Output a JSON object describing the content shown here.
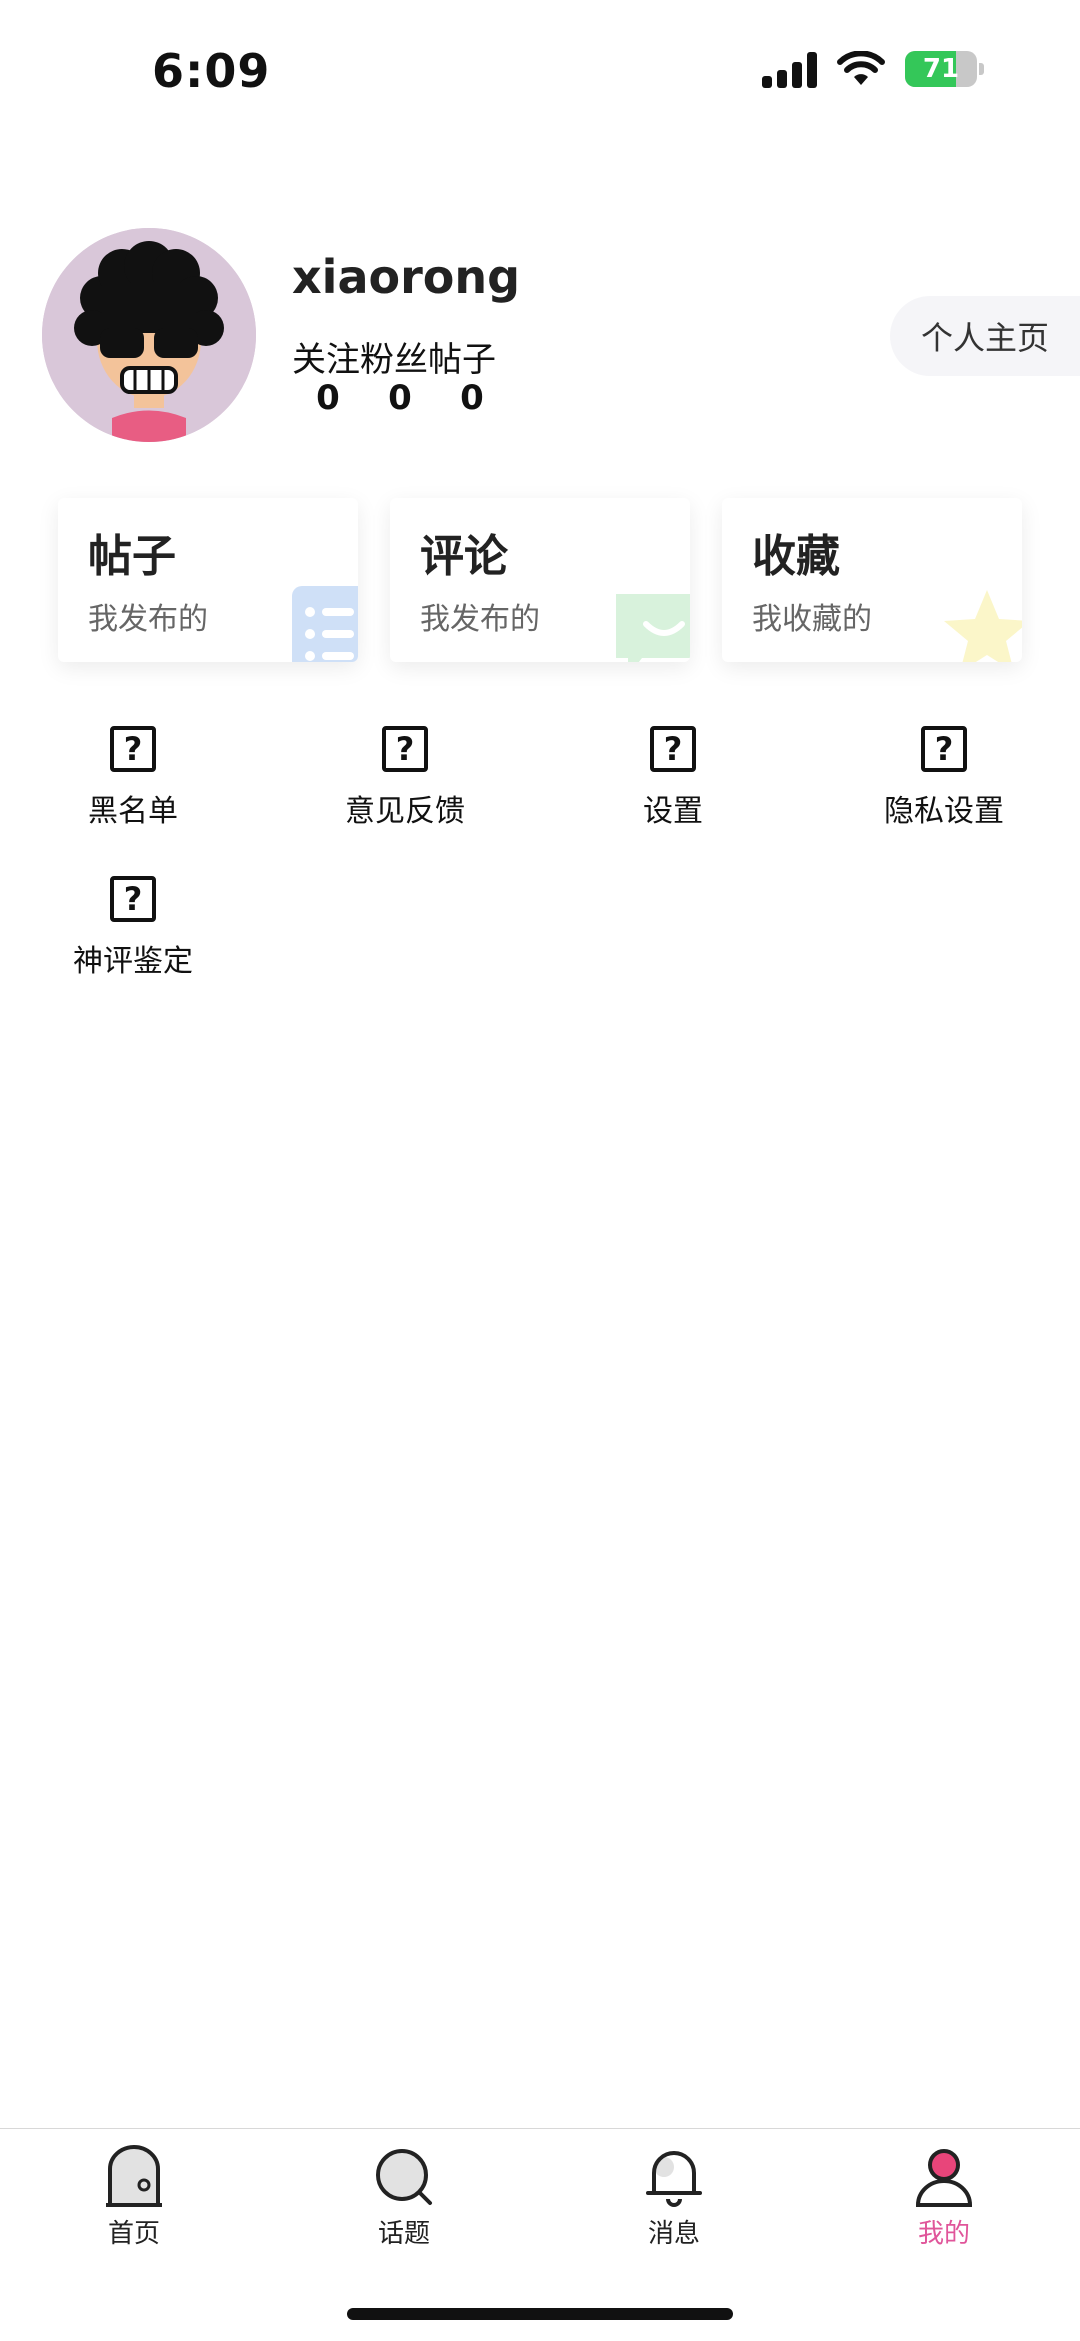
{
  "status_bar": {
    "time": "6:09",
    "battery_level": "71",
    "icons": [
      "signal-icon",
      "wifi-icon",
      "battery-icon"
    ]
  },
  "profile": {
    "username": "xiaorong",
    "stats": [
      {
        "label": "关注",
        "value": "0"
      },
      {
        "label": "粉丝",
        "value": "0"
      },
      {
        "label": "帖子",
        "value": "0"
      }
    ],
    "home_button": "个人主页"
  },
  "cards": [
    {
      "title": "帖子",
      "subtitle": "我发布的",
      "icon": "list-icon",
      "accent": "#cfe0f7"
    },
    {
      "title": "评论",
      "subtitle": "我发布的",
      "icon": "comment-icon",
      "accent": "#d8f2dc"
    },
    {
      "title": "收藏",
      "subtitle": "我收藏的",
      "icon": "star-icon",
      "accent": "#fbf6c9"
    }
  ],
  "menu": [
    {
      "label": "黑名单",
      "icon": "question-icon"
    },
    {
      "label": "意见反馈",
      "icon": "question-icon"
    },
    {
      "label": "设置",
      "icon": "question-icon"
    },
    {
      "label": "隐私设置",
      "icon": "question-icon"
    },
    {
      "label": "神评鉴定",
      "icon": "question-icon"
    }
  ],
  "tabs": [
    {
      "label": "首页",
      "icon": "home-icon",
      "active": false
    },
    {
      "label": "话题",
      "icon": "topic-icon",
      "active": false
    },
    {
      "label": "消息",
      "icon": "bell-icon",
      "active": false
    },
    {
      "label": "我的",
      "icon": "user-icon",
      "active": true
    }
  ],
  "colors": {
    "accent": "#e0559a",
    "battery": "#34c759"
  }
}
